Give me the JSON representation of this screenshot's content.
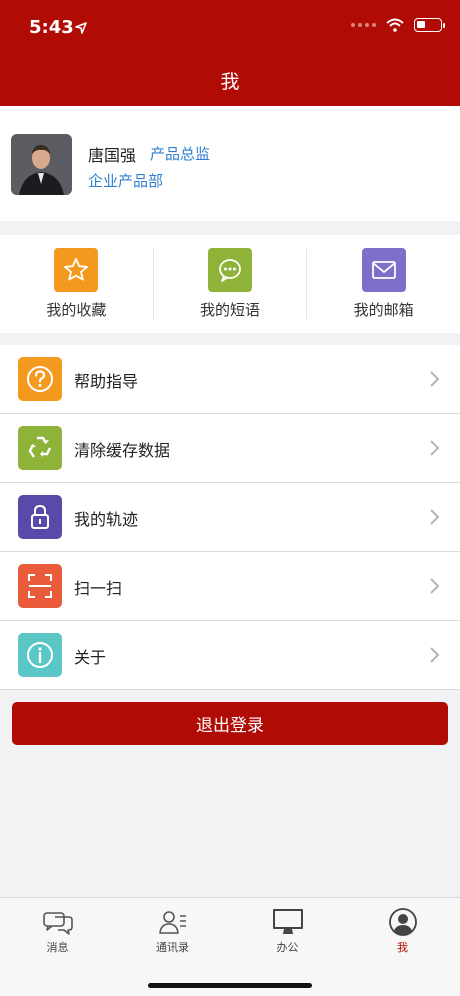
{
  "status": {
    "time": "5:43"
  },
  "header": {
    "title": "我"
  },
  "profile": {
    "name": "唐国强",
    "role": "产品总监",
    "department": "企业产品部"
  },
  "quick_actions": [
    {
      "label": "我的收藏",
      "icon": "star-icon",
      "color": "#f39a1e"
    },
    {
      "label": "我的短语",
      "icon": "chat-bubble-icon",
      "color": "#8fb339"
    },
    {
      "label": "我的邮箱",
      "icon": "mail-icon",
      "color": "#7e6fc9"
    }
  ],
  "menu": [
    {
      "label": "帮助指导",
      "icon": "help-icon",
      "color": "#f39a1e"
    },
    {
      "label": "清除缓存数据",
      "icon": "recycle-icon",
      "color": "#8fb339"
    },
    {
      "label": "我的轨迹",
      "icon": "lock-icon",
      "color": "#5a49a8"
    },
    {
      "label": "扫一扫",
      "icon": "scan-icon",
      "color": "#ea5b3c"
    },
    {
      "label": "关于",
      "icon": "info-icon",
      "color": "#5bc6c6"
    }
  ],
  "logout": {
    "label": "退出登录"
  },
  "tabbar": [
    {
      "label": "消息",
      "icon": "message-icon",
      "active": false
    },
    {
      "label": "通讯录",
      "icon": "contacts-icon",
      "active": false
    },
    {
      "label": "办公",
      "icon": "monitor-icon",
      "active": false
    },
    {
      "label": "我",
      "icon": "profile-icon",
      "active": true
    }
  ],
  "colors": {
    "brand": "#b00b05",
    "link": "#2f7fd0"
  }
}
